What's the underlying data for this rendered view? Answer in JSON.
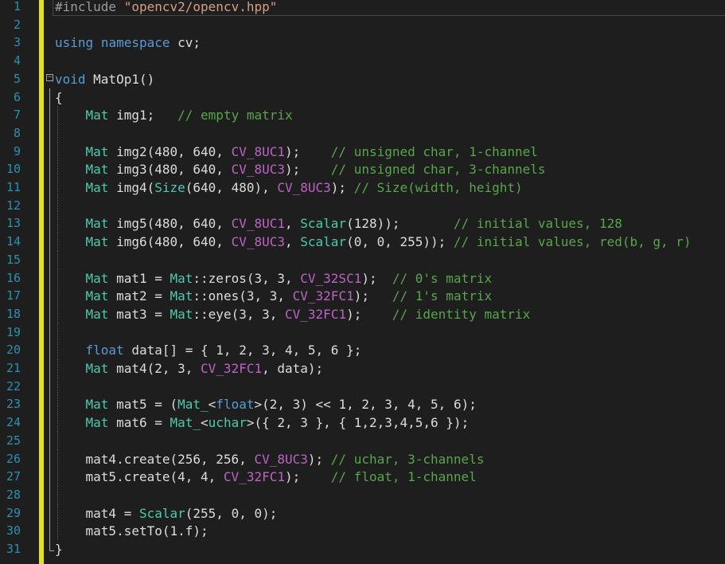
{
  "editor": {
    "line_numbers": [
      "1",
      "2",
      "3",
      "4",
      "5",
      "6",
      "7",
      "8",
      "9",
      "10",
      "11",
      "12",
      "13",
      "14",
      "15",
      "16",
      "17",
      "18",
      "19",
      "20",
      "21",
      "22",
      "23",
      "24",
      "25",
      "26",
      "27",
      "28",
      "29",
      "30",
      "31"
    ],
    "fold_icon": "minus-box-icon",
    "colors": {
      "background": "#1e1e1e",
      "line_number": "#2b91af",
      "change_bar": "#e2e21a",
      "keyword": "#569cd6",
      "type": "#4ec9b0",
      "macro": "#bd63c5",
      "comment": "#57a64a",
      "string": "#d69d85",
      "plain": "#dcdcdc"
    },
    "lines": [
      [
        [
          "pp",
          "#include "
        ],
        [
          "str",
          "\"opencv2/opencv.hpp\""
        ]
      ],
      [],
      [
        [
          "kw",
          "using"
        ],
        [
          "pl",
          " "
        ],
        [
          "kw",
          "namespace"
        ],
        [
          "pl",
          " cv;"
        ]
      ],
      [],
      [
        [
          "kw",
          "void"
        ],
        [
          "pl",
          " MatOp1()"
        ]
      ],
      [
        [
          "pl",
          "{"
        ]
      ],
      [
        [
          "pl",
          "    "
        ],
        [
          "type",
          "Mat"
        ],
        [
          "pl",
          " img1;   "
        ],
        [
          "cmt",
          "// empty matrix"
        ]
      ],
      [],
      [
        [
          "pl",
          "    "
        ],
        [
          "type",
          "Mat"
        ],
        [
          "pl",
          " img2(480, 640, "
        ],
        [
          "mac",
          "CV_8UC1"
        ],
        [
          "pl",
          ");    "
        ],
        [
          "cmt",
          "// unsigned char, 1-channel"
        ]
      ],
      [
        [
          "pl",
          "    "
        ],
        [
          "type",
          "Mat"
        ],
        [
          "pl",
          " img3(480, 640, "
        ],
        [
          "mac",
          "CV_8UC3"
        ],
        [
          "pl",
          ");    "
        ],
        [
          "cmt",
          "// unsigned char, 3-channels"
        ]
      ],
      [
        [
          "pl",
          "    "
        ],
        [
          "type",
          "Mat"
        ],
        [
          "pl",
          " img4("
        ],
        [
          "type",
          "Size"
        ],
        [
          "pl",
          "(640, 480), "
        ],
        [
          "mac",
          "CV_8UC3"
        ],
        [
          "pl",
          "); "
        ],
        [
          "cmt",
          "// Size(width, height)"
        ]
      ],
      [],
      [
        [
          "pl",
          "    "
        ],
        [
          "type",
          "Mat"
        ],
        [
          "pl",
          " img5(480, 640, "
        ],
        [
          "mac",
          "CV_8UC1"
        ],
        [
          "pl",
          ", "
        ],
        [
          "type",
          "Scalar"
        ],
        [
          "pl",
          "(128));       "
        ],
        [
          "cmt",
          "// initial values, 128"
        ]
      ],
      [
        [
          "pl",
          "    "
        ],
        [
          "type",
          "Mat"
        ],
        [
          "pl",
          " img6(480, 640, "
        ],
        [
          "mac",
          "CV_8UC3"
        ],
        [
          "pl",
          ", "
        ],
        [
          "type",
          "Scalar"
        ],
        [
          "pl",
          "(0, 0, 255)); "
        ],
        [
          "cmt",
          "// initial values, red(b, g, r)"
        ]
      ],
      [],
      [
        [
          "pl",
          "    "
        ],
        [
          "type",
          "Mat"
        ],
        [
          "pl",
          " mat1 = "
        ],
        [
          "type",
          "Mat"
        ],
        [
          "pl",
          "::zeros(3, 3, "
        ],
        [
          "mac",
          "CV_32SC1"
        ],
        [
          "pl",
          ");  "
        ],
        [
          "cmt",
          "// 0's matrix"
        ]
      ],
      [
        [
          "pl",
          "    "
        ],
        [
          "type",
          "Mat"
        ],
        [
          "pl",
          " mat2 = "
        ],
        [
          "type",
          "Mat"
        ],
        [
          "pl",
          "::ones(3, 3, "
        ],
        [
          "mac",
          "CV_32FC1"
        ],
        [
          "pl",
          ");   "
        ],
        [
          "cmt",
          "// 1's matrix"
        ]
      ],
      [
        [
          "pl",
          "    "
        ],
        [
          "type",
          "Mat"
        ],
        [
          "pl",
          " mat3 = "
        ],
        [
          "type",
          "Mat"
        ],
        [
          "pl",
          "::eye(3, 3, "
        ],
        [
          "mac",
          "CV_32FC1"
        ],
        [
          "pl",
          ");    "
        ],
        [
          "cmt",
          "// identity matrix"
        ]
      ],
      [],
      [
        [
          "pl",
          "    "
        ],
        [
          "kw",
          "float"
        ],
        [
          "pl",
          " data[] = { 1, 2, 3, 4, 5, 6 };"
        ]
      ],
      [
        [
          "pl",
          "    "
        ],
        [
          "type",
          "Mat"
        ],
        [
          "pl",
          " mat4(2, 3, "
        ],
        [
          "mac",
          "CV_32FC1"
        ],
        [
          "pl",
          ", data);"
        ]
      ],
      [],
      [
        [
          "pl",
          "    "
        ],
        [
          "type",
          "Mat"
        ],
        [
          "pl",
          " mat5 = ("
        ],
        [
          "type",
          "Mat_"
        ],
        [
          "pl",
          "<"
        ],
        [
          "kw",
          "float"
        ],
        [
          "pl",
          ">(2, 3) << 1, 2, 3, 4, 5, 6);"
        ]
      ],
      [
        [
          "pl",
          "    "
        ],
        [
          "type",
          "Mat"
        ],
        [
          "pl",
          " mat6 = "
        ],
        [
          "type",
          "Mat_"
        ],
        [
          "pl",
          "<"
        ],
        [
          "type",
          "uchar"
        ],
        [
          "pl",
          ">({ 2, 3 }, { 1,2,3,4,5,6 });"
        ]
      ],
      [],
      [
        [
          "pl",
          "    mat4.create(256, 256, "
        ],
        [
          "mac",
          "CV_8UC3"
        ],
        [
          "pl",
          "); "
        ],
        [
          "cmt",
          "// uchar, 3-channels"
        ]
      ],
      [
        [
          "pl",
          "    mat5.create(4, 4, "
        ],
        [
          "mac",
          "CV_32FC1"
        ],
        [
          "pl",
          ");    "
        ],
        [
          "cmt",
          "// float, 1-channel"
        ]
      ],
      [],
      [
        [
          "pl",
          "    mat4 = "
        ],
        [
          "type",
          "Scalar"
        ],
        [
          "pl",
          "(255, 0, 0);"
        ]
      ],
      [
        [
          "pl",
          "    mat5.setTo(1.f);"
        ]
      ],
      [
        [
          "pl",
          "}"
        ]
      ]
    ]
  }
}
